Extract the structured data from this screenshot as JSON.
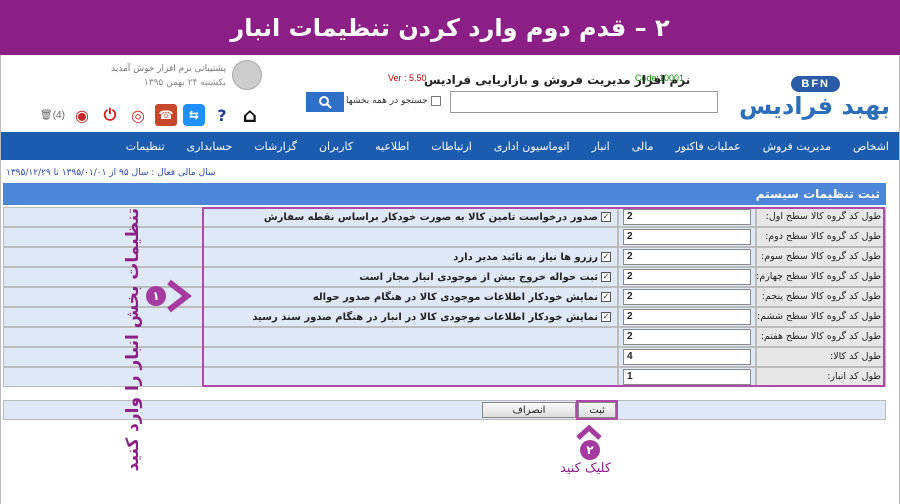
{
  "banner": {
    "title": "۲ – قدم دوم وارد کردن تنظیمات انبار"
  },
  "header": {
    "logo_badge": "BFN",
    "logo_name": "بهبد فرادیس",
    "app_title": "نرم افزار مدیریت فروش و بازاریابی فرادیس",
    "version": "Ver : 5.50",
    "code": "Code:10001",
    "search": {
      "placeholder": "",
      "search_all_label": "جستجو در همه بخشها"
    },
    "user": {
      "welcome": "پشتیبانی نرم افزار خوش آمدید",
      "date": "یکشنبه ۲۴ بهمن ۱۳۹۵"
    },
    "trash_count": "(4)"
  },
  "nav": {
    "items": [
      "اشخاص",
      "مدیریت فروش",
      "عملیات فاکتور",
      "مالی",
      "انبار",
      "اتوماسیون اداری",
      "ارتباطات",
      "اطلاعیه",
      "کاربران",
      "گزارشات",
      "حسابداری",
      "تنظیمات"
    ]
  },
  "fiscal": "سال مالی فعال : سال ۹۵ از ۱۳۹۵/۰۱/۰۱ تا ۱۳۹۵/۱۲/۲۹",
  "form": {
    "section_title": "ثبت تنظیمات سیستم",
    "rows": [
      {
        "label": "طول کد گروه کالا سطح اول:",
        "value": "2",
        "option": "صدور درخواست تامین کالا به صورت خودکار براساس نقطه سفارش"
      },
      {
        "label": "طول کد گروه کالا سطح دوم:",
        "value": "2",
        "option": ""
      },
      {
        "label": "طول کد گروه کالا سطح سوم:",
        "value": "2",
        "option": "رزرو ها نیاز به تائید مدیر دارد"
      },
      {
        "label": "طول کد گروه کالا سطح چهارم:",
        "value": "2",
        "option": "ثبت حواله خروج بیش از موجودی انبار مجاز است"
      },
      {
        "label": "طول کد گروه کالا سطح پنجم:",
        "value": "2",
        "option": "نمایش خودکار اطلاعات موجودی کالا در هنگام صدور حواله"
      },
      {
        "label": "طول کد گروه کالا سطح ششم:",
        "value": "2",
        "option": "نمایش خودکار اطلاعات موجودی کالا در انبار در هنگام صدور سند رسید"
      },
      {
        "label": "طول کد گروه کالا سطح هفتم:",
        "value": "2",
        "option": ""
      },
      {
        "label": "طول کد کالا:",
        "value": "4",
        "option": ""
      },
      {
        "label": "طول کد انبار:",
        "value": "1",
        "option": ""
      }
    ],
    "submit_label": "ثبت",
    "cancel_label": "انصراف"
  },
  "annotations": {
    "step1_number": "۱",
    "step1_text": "تنظیمات بخش انبار را وارد کنید",
    "step2_number": "۲",
    "step2_text": "کلیک کنید"
  },
  "colors": {
    "banner": "#8c1f86",
    "nav": "#1c5caf",
    "section": "#4d86d8",
    "highlight": "#b04aa9"
  }
}
